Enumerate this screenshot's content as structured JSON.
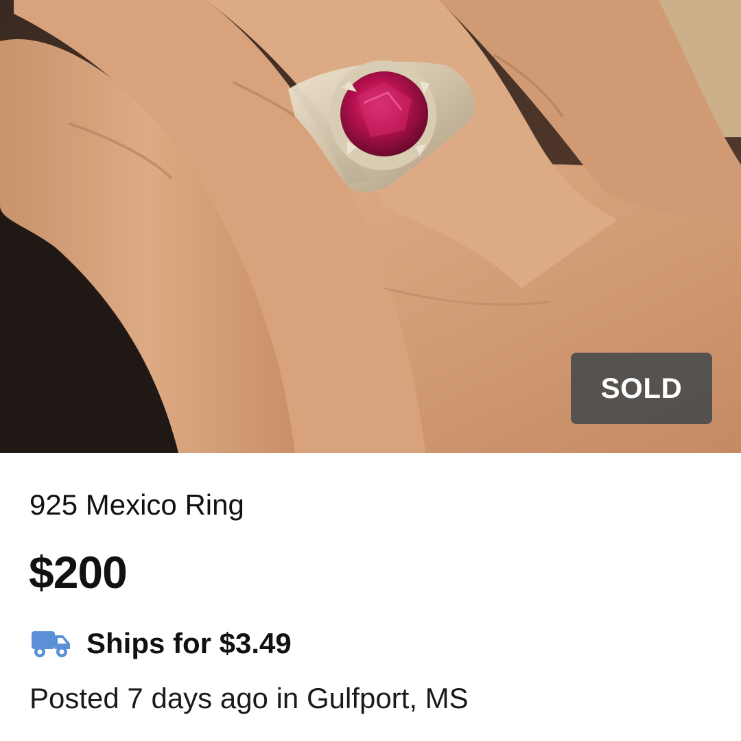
{
  "listing": {
    "badge": "SOLD",
    "title": "925 Mexico Ring",
    "price": "$200",
    "shipping": {
      "icon": "truck-icon",
      "text": "Ships for $3.49"
    },
    "posted": "Posted 7 days ago in Gulfport, MS"
  },
  "colors": {
    "badge_background": "#4e4e4e",
    "text": "#111111",
    "truck_icon": "#5b8fd6"
  }
}
